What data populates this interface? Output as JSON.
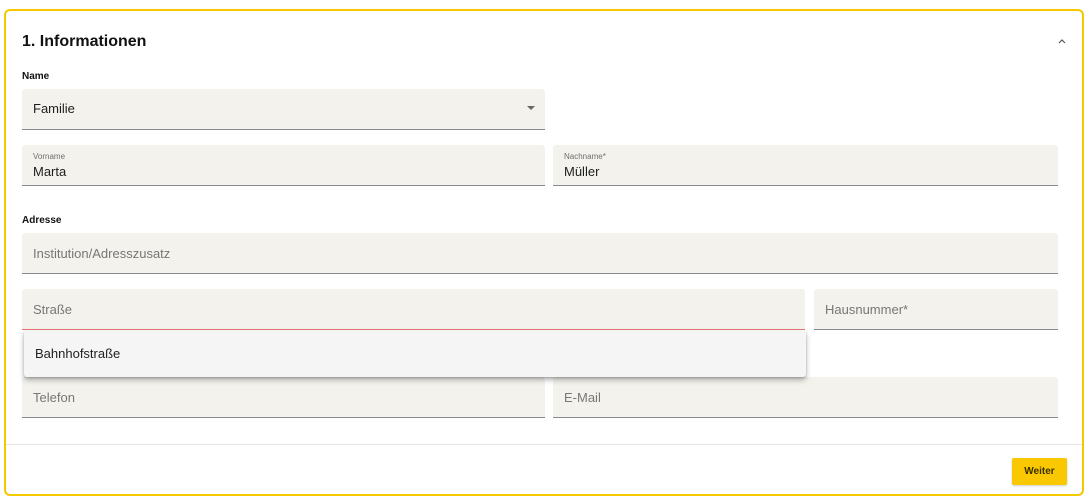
{
  "section": {
    "title": "1. Informationen"
  },
  "name_section": {
    "label": "Name",
    "salutation": {
      "value": "Familie"
    },
    "first_name": {
      "label": "Vorname",
      "value": "Marta"
    },
    "last_name": {
      "label": "Nachname*",
      "value": "Müller"
    }
  },
  "address_section": {
    "label": "Adresse",
    "institution": {
      "placeholder": "Institution/Adresszusatz"
    },
    "street": {
      "placeholder": "Straße"
    },
    "house_number": {
      "placeholder": "Hausnummer*"
    },
    "autocomplete_options": [
      "Bahnhofstraße"
    ]
  },
  "contact": {
    "phone": {
      "placeholder": "Telefon"
    },
    "email": {
      "placeholder": "E-Mail"
    }
  },
  "footer": {
    "next_label": "Weiter"
  },
  "colors": {
    "accent": "#f9c800",
    "panel_border": "#f5c800",
    "field_background": "#f3f2ec",
    "error_underline": "#e57373"
  },
  "icons": {
    "collapse": "chevron-up-icon",
    "dropdown": "caret-down-icon"
  }
}
